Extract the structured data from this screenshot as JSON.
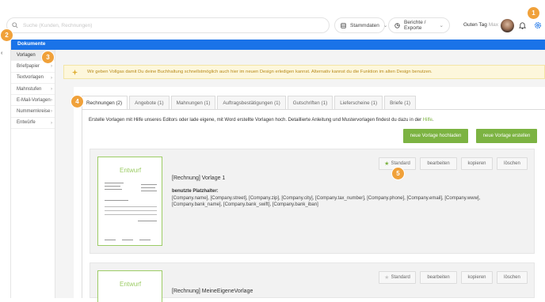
{
  "topbar": {
    "search_placeholder": "Suche (Kunden, Rechnungen)",
    "stammdaten_label": "Stammdaten",
    "berichte_label": "Berichte / Exporte",
    "greeting": "Guten Tag",
    "user_name": "Max"
  },
  "blue_bar": {
    "title": "Dokumente"
  },
  "sidebar": {
    "items": [
      {
        "label": "Vorlagen",
        "active": true
      },
      {
        "label": "Briefpapier",
        "has_chevron": true
      },
      {
        "label": "Textvorlagen",
        "has_chevron": true
      },
      {
        "label": "Mahnstufen",
        "has_chevron": true
      },
      {
        "label": "E-Mail-Vorlagen",
        "has_chevron": true
      },
      {
        "label": "Nummernkreise",
        "has_chevron": true
      },
      {
        "label": "Entwürfe",
        "has_chevron": true
      }
    ]
  },
  "notice": {
    "text": "Wir geben Vollgas damit Du deine Buchhaltung schnellstmöglich auch hier im neuen Design erledigen kannst. Alternativ kannst du die Funktion im alten Design benutzen."
  },
  "tabs": [
    {
      "label": "Rechnungen (2)",
      "active": true
    },
    {
      "label": "Angebote (1)"
    },
    {
      "label": "Mahnungen (1)"
    },
    {
      "label": "Auftragsbestätigungen (1)"
    },
    {
      "label": "Gutschriften (1)"
    },
    {
      "label": "Lieferscheine (1)"
    },
    {
      "label": "Briefe (1)"
    }
  ],
  "intro": {
    "text": "Erstelle Vorlagen mit Hilfe unseres Editors oder lade eigene, mit Word erstellte Vorlagen hoch. Detaillierte Anleitung und Mustervorlagen findest du dazu in der ",
    "link": "Hilfe",
    "suffix": "."
  },
  "buttons": {
    "upload": "neue Vorlage hochladen",
    "create": "neue Vorlage erstellen"
  },
  "templates": [
    {
      "title": "[Rechnung] Vorlage 1",
      "watermark": "Entwurf",
      "placeholders_label": "benutzte Platzhalter:",
      "placeholders": "[Company.name], [Company.street], [Company.zip], [Company.city], [Company.tax_number], [Company.phone], [Company.email], [Company.www], [Company.bank_name], [Company.bank_swift], [Company.bank_iban]",
      "actions": {
        "standard": "Standard",
        "edit": "bearbeiten",
        "copy": "kopieren",
        "delete": "löschen"
      },
      "is_standard": true
    },
    {
      "title": "[Rechnung] MeineEigeneVorlage",
      "watermark": "Entwurf",
      "actions": {
        "standard": "Standard",
        "edit": "bearbeiten",
        "copy": "kopieren",
        "delete": "löschen"
      },
      "is_standard": false
    }
  ],
  "callouts": [
    "1",
    "2",
    "3",
    "4",
    "5"
  ],
  "colors": {
    "accent_blue": "#1a73e8",
    "green": "#7cb342",
    "badge_orange": "#f0a13a",
    "notice_bg": "#fdf7dc"
  },
  "icons": [
    "search-icon",
    "database-icon",
    "chart-icon",
    "bell-icon",
    "gear-icon",
    "chevron-left-icon",
    "star-icon",
    "tip-icon"
  ]
}
